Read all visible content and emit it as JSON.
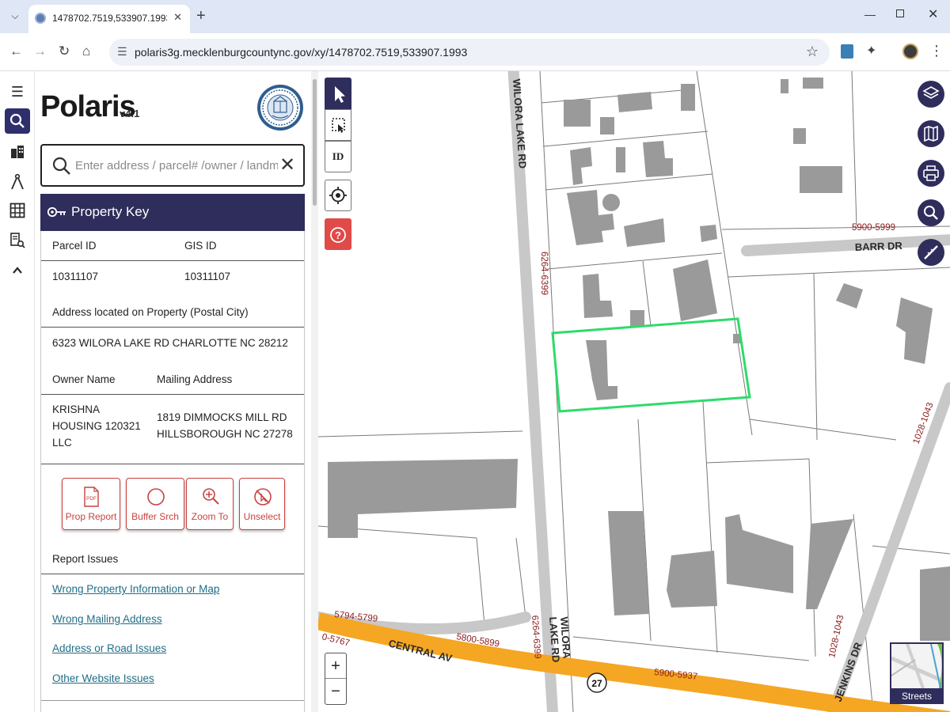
{
  "browser": {
    "tab_title": "1478702.7519,533907.1993 - Pol",
    "new_tab": "+",
    "url": "polaris3g.mecklenburgcountync.gov/xy/1478702.7519,533907.1993"
  },
  "app": {
    "title": "Polaris",
    "version": "v4.1"
  },
  "search": {
    "placeholder": "Enter address / parcel# /owner / landmark"
  },
  "property_key": {
    "title": "Property Key",
    "parcel_id_label": "Parcel ID",
    "gis_id_label": "GIS ID",
    "parcel_id": "10311107",
    "gis_id": "10311107",
    "address_label": "Address located on Property (Postal City)",
    "address": "6323 WILORA LAKE RD CHARLOTTE NC 28212",
    "owner_label": "Owner Name",
    "mailing_label": "Mailing Address",
    "owner_lines": [
      "KRISHNA",
      "HOUSING 120321",
      "LLC"
    ],
    "mailing_lines": [
      "1819 DIMMOCKS MILL RD",
      "HILLSBOROUGH NC 27278"
    ]
  },
  "actions": {
    "prop_report": "Prop Report",
    "pdf_badge": "PDF",
    "buffer_search": "Buffer Srch",
    "zoom_to": "Zoom To",
    "unselect": "Unselect"
  },
  "report_issues": {
    "title": "Report Issues",
    "links": [
      "Wrong Property Information or Map",
      "Wrong Mailing Address",
      "Address or Road Issues",
      "Other Website Issues"
    ]
  },
  "map": {
    "id_tool_label": "ID",
    "basemap_label": "Streets",
    "zoom_in": "+",
    "zoom_out": "−",
    "shield_number": "27",
    "streets": {
      "wilora_lake_rd_top": "WILORA LAKE RD",
      "wilora_lake_rd_bottom_1": "WILORA",
      "wilora_lake_rd_bottom_2": "LAKE RD",
      "barr_dr": "BARR DR",
      "central_av": "CENTRAL AV",
      "jenkins_dr": "JENKINS DR"
    },
    "address_ranges": {
      "r_6264_6399_top": "6264-6399",
      "r_6264_6399_bottom": "6264-6399",
      "r_5900_5999": "5900-5999",
      "r_1028_1043_right": "1028-1043",
      "r_1028_1043_bottom": "1028-1043",
      "r_5794_5799": "5794-5799",
      "r_0_5767": "0-5767",
      "r_5800_5899": "5800-5899",
      "r_5900_5937": "5900-5937"
    },
    "colors": {
      "parcel_highlight": "#2edb6a",
      "building": "#9a9a9a",
      "road": "#c8c8c8",
      "highway": "#f5a623",
      "label_red": "#8b1a1a"
    }
  }
}
